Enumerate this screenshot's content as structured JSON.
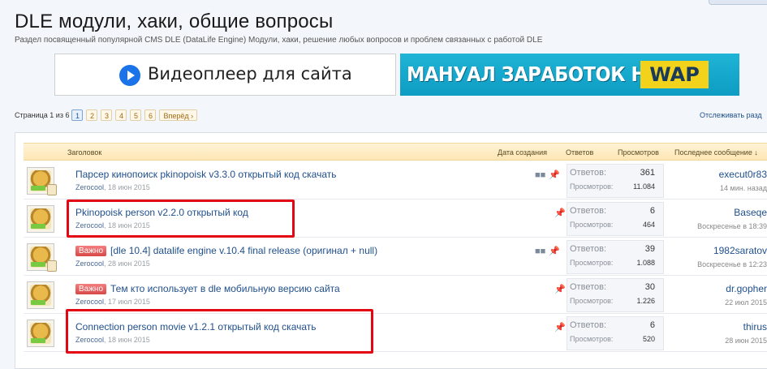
{
  "forum": {
    "title": "DLE модули, хаки, общие вопросы",
    "description": "Раздел посвященный популярной CMS DLE (DataLife Engine) Модули, хаки, решение любых вопросов и проблем связанных с работой DLE"
  },
  "banners": {
    "left_text": "Видеоплеер для сайта",
    "right_text": "МАНУАЛ ЗАРАБОТОК НА",
    "right_highlight": "WAP"
  },
  "pagination": {
    "label": "Страница 1 из 6",
    "pages": [
      "1",
      "2",
      "3",
      "4",
      "5",
      "6"
    ],
    "current": "1",
    "next_label": "Вперёд ›"
  },
  "watch_link": "Отслеживать разд",
  "table": {
    "headers": {
      "title": "Заголовок",
      "created": "Дата создания",
      "replies": "Ответов",
      "views": "Просмотров",
      "last": "Последнее сообщение ↓"
    },
    "stat_labels": {
      "replies": "Ответов:",
      "views": "Просмотров:"
    },
    "rows": [
      {
        "title": "Парсер кинопоиск pkinopoisk v3.3.0 открытый код скачать",
        "important": "",
        "author": "Zerocool",
        "date": "18 июн 2015",
        "replies": "361",
        "views": "11.084",
        "last_user": "execut0r83",
        "last_date": "14 мин. назад"
      },
      {
        "title": "Pkinopoisk person v2.2.0 открытый код",
        "important": "",
        "author": "Zerocool",
        "date": "18 июн 2015",
        "replies": "6",
        "views": "464",
        "last_user": "Baseqe",
        "last_date": "Воскресенье в 18:39"
      },
      {
        "title": "[dle 10.4] datalife engine v.10.4 final release (оригинал + null)",
        "important": "Важно",
        "author": "Zerocool",
        "date": "28 июн 2015",
        "replies": "39",
        "views": "1.088",
        "last_user": "1982saratov",
        "last_date": "Воскресенье в 12:23"
      },
      {
        "title": "Тем кто использует в dle мобильную версию сайта",
        "important": "Важно",
        "author": "Zerocool",
        "date": "17 июл 2015",
        "replies": "30",
        "views": "1.226",
        "last_user": "dr.gopher",
        "last_date": "22 июл 2015"
      },
      {
        "title": "Connection person movie v1.2.1 открытый код скачать",
        "important": "",
        "author": "Zerocool",
        "date": "18 июн 2015",
        "replies": "6",
        "views": "520",
        "last_user": "thirus",
        "last_date": "28 июн 2015"
      }
    ]
  },
  "colors": {
    "highlight": "#e30613",
    "link": "#1f4f8c",
    "accent": "#f2d21a"
  },
  "icons": {
    "multipage": "multipage-icon",
    "sticky": "pin-icon"
  }
}
